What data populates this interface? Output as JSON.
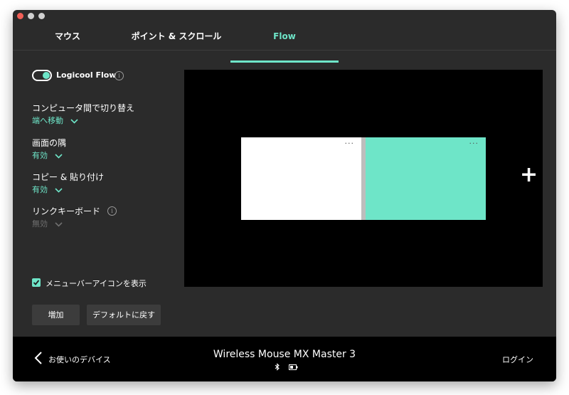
{
  "tabs": [
    {
      "label": "マウス"
    },
    {
      "label": "ポイント & スクロール"
    },
    {
      "label": "Flow"
    }
  ],
  "flow_toggle": {
    "label": "Logicool Flow",
    "on": true
  },
  "settings": {
    "switch_computers": {
      "title": "コンピュータ間で切り替え",
      "value": "端へ移動"
    },
    "screen_corner": {
      "title": "画面の隅",
      "value": "有効"
    },
    "copy_paste": {
      "title": "コピー & 貼り付け",
      "value": "有効"
    },
    "link_keyboard": {
      "title": "リンクキーボード",
      "value": "無効"
    }
  },
  "menu_bar_icon": {
    "label": "メニューバーアイコンを表示",
    "checked": true
  },
  "buttons": {
    "add": "増加",
    "reset": "デフォルトに戻す"
  },
  "canvas": {
    "more_symbol": "···",
    "add_symbol": "+"
  },
  "footer": {
    "back_label": "お使いのデバイス",
    "device_name": "Wireless Mouse MX Master 3",
    "login_label": "ログイン"
  },
  "colors": {
    "accent": "#6ee5c8",
    "background": "#2b2b2b",
    "canvas": "#000000"
  }
}
